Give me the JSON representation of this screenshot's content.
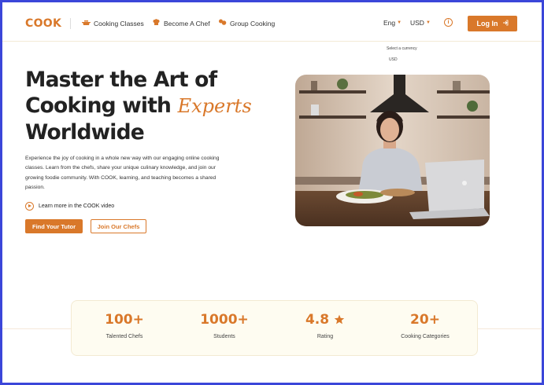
{
  "nav": {
    "logo": "COOK",
    "items": [
      {
        "label": "Cooking Classes",
        "icon": "pot-icon"
      },
      {
        "label": "Become A Chef",
        "icon": "chef-hat-icon"
      },
      {
        "label": "Group Cooking",
        "icon": "people-icon"
      }
    ],
    "language": "Eng",
    "currency": "USD",
    "login_label": "Log In",
    "currency_dropdown": {
      "hint": "Select a currency",
      "options": [
        "USD"
      ]
    }
  },
  "hero": {
    "title_line1": "Master the Art of",
    "title_line2": "Cooking with",
    "title_script": "Experts",
    "title_line3": "Worldwide",
    "description": "Experience the joy of cooking in a whole new way with our engaging online cooking classes. Learn from the chefs, share your unique culinary knowledge, and join our growing foodie community. With COOK, learning, and teaching becomes a shared passion.",
    "video_link": "Learn more in the COOK video",
    "primary_button": "Find Your Tutor",
    "secondary_button": "Join Our Chefs"
  },
  "stats": [
    {
      "value": "100+",
      "label": "Talented Chefs"
    },
    {
      "value": "1000+",
      "label": "Students"
    },
    {
      "value": "4.8",
      "label": "Rating",
      "icon": "star-icon"
    },
    {
      "value": "20+",
      "label": "Cooking Categories"
    }
  ],
  "colors": {
    "accent": "#d9782a",
    "frame": "#3b46d9"
  }
}
